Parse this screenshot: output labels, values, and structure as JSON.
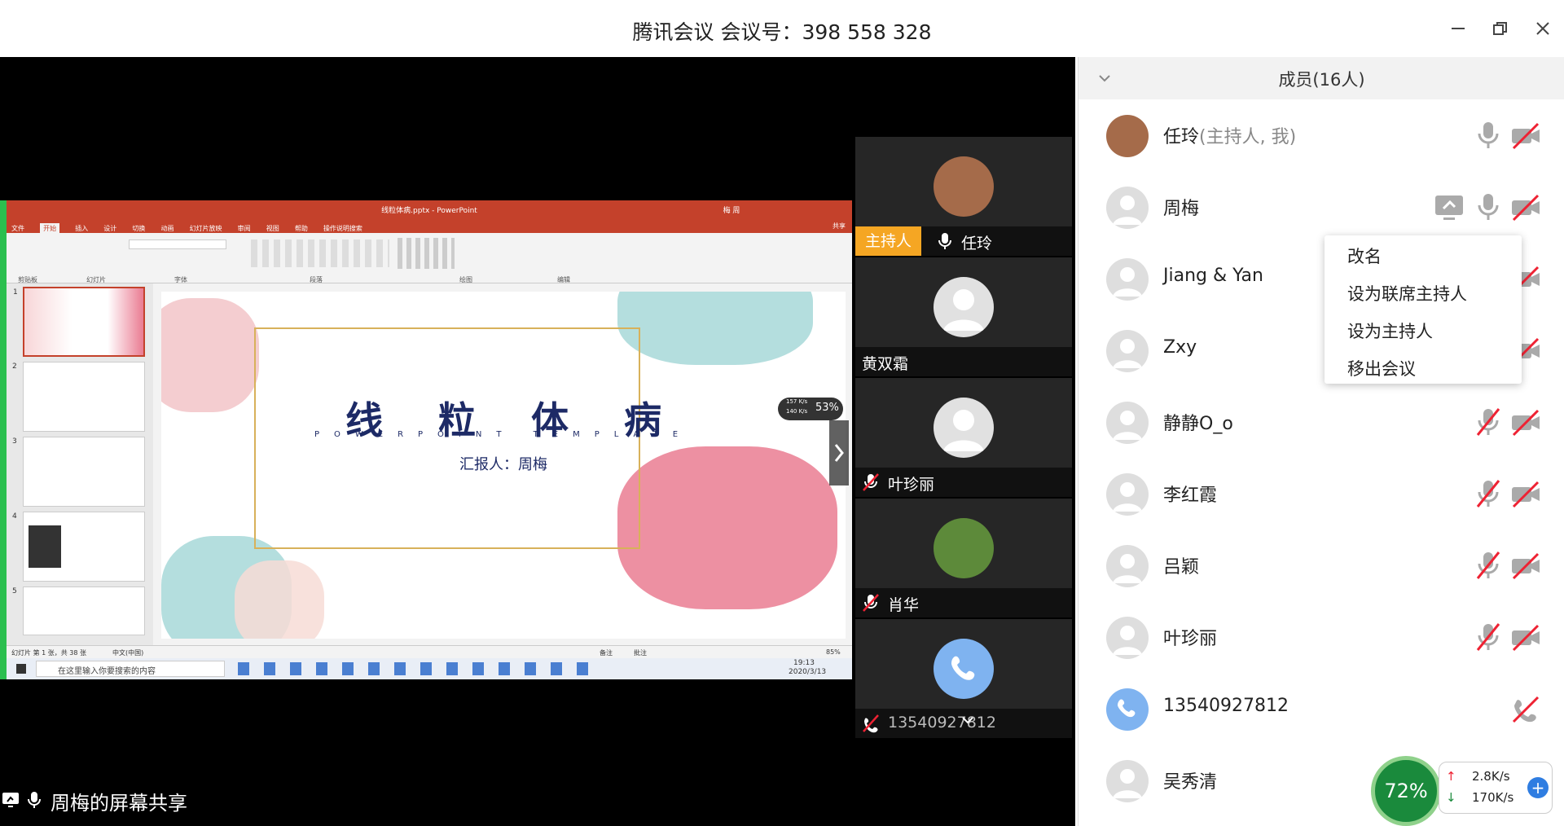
{
  "window": {
    "title": "腾讯会议 会议号：398 558 328",
    "controls": [
      "minimize-icon",
      "restore-icon",
      "close-icon"
    ]
  },
  "share": {
    "label": "周梅的屏幕共享",
    "ppt": {
      "window_title": "线粒体病.pptx - PowerPoint",
      "user": "梅 周",
      "share_btn": "共享",
      "menu": [
        "文件",
        "开始",
        "插入",
        "设计",
        "切换",
        "动画",
        "幻灯片放映",
        "审阅",
        "视图",
        "帮助",
        "操作说明搜索"
      ],
      "ribbon_groups": [
        "剪贴板",
        "幻灯片",
        "字体",
        "段落",
        "绘图",
        "编辑"
      ],
      "thumbs": [
        "1",
        "2",
        "3",
        "4",
        "5"
      ],
      "slide_title": "线 粒 体 病",
      "slide_subtitle": "POWERPOINT TEMPLATE",
      "slide_reporter": "汇报人：周梅",
      "status_left": "幻灯片 第 1 张，共 38 张",
      "status_lang": "中文(中国)",
      "status_notes": "备注",
      "status_comments": "批注",
      "zoom": "85%",
      "taskbar_search": "在这里输入你要搜索的内容",
      "clock_time": "19:13",
      "clock_date": "2020/3/13",
      "net_up": "157 K/s",
      "net_down": "140 K/s",
      "net_percent": "53%"
    }
  },
  "videos": [
    {
      "name": "任玲",
      "host_badge": "主持人",
      "mic": "on"
    },
    {
      "name": "黄双霜",
      "mic": "none"
    },
    {
      "name": "叶珍丽",
      "mic": "muted"
    },
    {
      "name": "肖华",
      "mic": "muted"
    },
    {
      "name": "13540927812",
      "mic": "phone-muted"
    }
  ],
  "members": {
    "header": "成员(16人)",
    "list": [
      {
        "name": "任玲",
        "tag": "(主持人, 我)",
        "mic": "on",
        "video": "off"
      },
      {
        "name": "周梅",
        "tag": "",
        "share": true,
        "mic": "on",
        "video": "off"
      },
      {
        "name": "Jiang & Yan",
        "tag": "",
        "video": "off"
      },
      {
        "name": "Zxy",
        "tag": "",
        "video": "off"
      },
      {
        "name": "静静O_o",
        "tag": "",
        "mic": "muted",
        "video": "off"
      },
      {
        "name": "李红霞",
        "tag": "",
        "mic": "muted",
        "video": "off"
      },
      {
        "name": "吕颖",
        "tag": "",
        "mic": "muted",
        "video": "off"
      },
      {
        "name": "叶珍丽",
        "tag": "",
        "mic": "muted",
        "video": "off"
      },
      {
        "name": "13540927812",
        "tag": "",
        "phone": true
      },
      {
        "name": "吴秀清",
        "tag": ""
      }
    ]
  },
  "context_menu": [
    "改名",
    "设为联席主持人",
    "设为主持人",
    "移出会议"
  ],
  "network": {
    "percent": "72%",
    "up": "2.8K/s",
    "down": "170K/s"
  },
  "colors": {
    "accent": "#f5a623",
    "ppt_red": "#c4412b",
    "share_green": "#2bbf4f"
  }
}
